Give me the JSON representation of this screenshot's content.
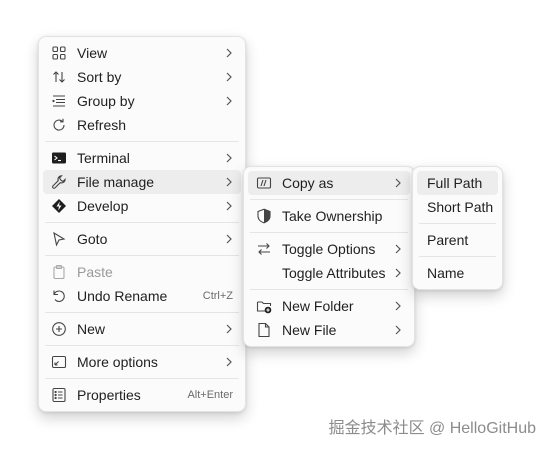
{
  "main_menu": {
    "view_label": "View",
    "sort_by_label": "Sort by",
    "group_by_label": "Group by",
    "refresh_label": "Refresh",
    "terminal_label": "Terminal",
    "file_manage_label": "File manage",
    "develop_label": "Develop",
    "goto_label": "Goto",
    "paste_label": "Paste",
    "undo_rename_label": "Undo Rename",
    "undo_rename_shortcut": "Ctrl+Z",
    "new_label": "New",
    "more_options_label": "More options",
    "properties_label": "Properties",
    "properties_shortcut": "Alt+Enter"
  },
  "file_manage_menu": {
    "copy_as_label": "Copy as",
    "take_ownership_label": "Take Ownership",
    "toggle_options_label": "Toggle Options",
    "toggle_attributes_label": "Toggle Attributes",
    "new_folder_label": "New Folder",
    "new_file_label": "New File"
  },
  "copy_as_menu": {
    "full_path_label": "Full Path",
    "short_path_label": "Short Path",
    "parent_label": "Parent",
    "name_label": "Name"
  },
  "watermark": "掘金技术社区 @ HelloGitHub",
  "colors": {
    "menu_bg": "#fbfbfb",
    "hover_bg": "#ededed",
    "disabled_text": "#9a9a9a",
    "separator": "#e5e5e5"
  }
}
